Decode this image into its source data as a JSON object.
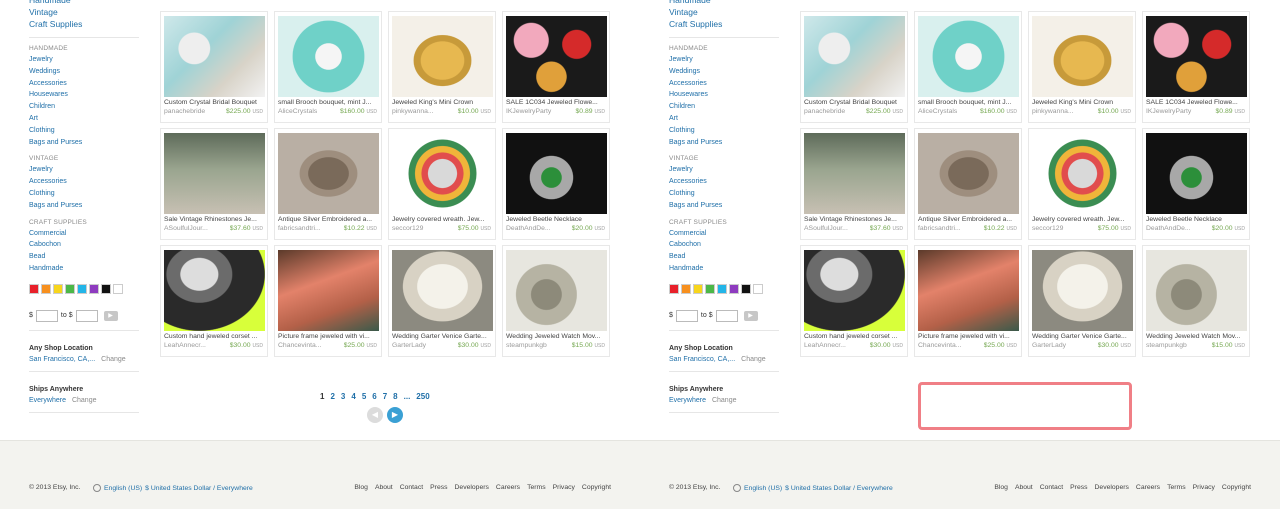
{
  "sidebar": {
    "top_links": [
      "Handmade",
      "Vintage",
      "Craft Supplies"
    ],
    "categories": [
      {
        "heading": "HANDMADE",
        "links": [
          "Jewelry",
          "Weddings",
          "Accessories",
          "Housewares",
          "Children",
          "Art",
          "Clothing",
          "Bags and Purses"
        ]
      },
      {
        "heading": "VINTAGE",
        "links": [
          "Jewelry",
          "Accessories",
          "Clothing",
          "Bags and Purses"
        ]
      },
      {
        "heading": "CRAFT SUPPLIES",
        "links": [
          "Commercial",
          "Cabochon",
          "Bead",
          "Handmade"
        ]
      }
    ],
    "colors": [
      "#e8202a",
      "#f7901e",
      "#f7d51d",
      "#4cb848",
      "#23b5e8",
      "#8e3bbf",
      "#111111",
      "#ffffff"
    ],
    "price_from_label": "$",
    "price_to_label": "to $",
    "shop_location_title": "Any Shop Location",
    "shop_location_value": "San Francisco, CA,...",
    "change_label": "Change",
    "ships_title": "Ships Anywhere",
    "ships_value": "Everywhere"
  },
  "listings": [
    {
      "title": "Custom Crystal Bridal Bouquet",
      "shop": "panachebride",
      "price": "$225.00",
      "currency": "USD"
    },
    {
      "title": "small Brooch bouquet, mint J...",
      "shop": "AliceCrystals",
      "price": "$160.00",
      "currency": "USD"
    },
    {
      "title": "Jeweled King's Mini Crown",
      "shop": "pinkywanna...",
      "price": "$10.00",
      "currency": "USD"
    },
    {
      "title": "SALE 1C034 Jeweled Flowe...",
      "shop": "IKJewelryParty",
      "price": "$0.89",
      "currency": "USD"
    },
    {
      "title": "Sale Vintage Rhinestones Je...",
      "shop": "ASoulfulJour...",
      "price": "$37.60",
      "currency": "USD"
    },
    {
      "title": "Antique Silver Embroidered a...",
      "shop": "fabricsandtri...",
      "price": "$10.22",
      "currency": "USD"
    },
    {
      "title": "Jewelry covered wreath. Jew...",
      "shop": "seccor129",
      "price": "$75.00",
      "currency": "USD"
    },
    {
      "title": "Jeweled Beetle Necklace",
      "shop": "DeathAndDe...",
      "price": "$20.00",
      "currency": "USD"
    },
    {
      "title": "Custom hand jeweled corset ...",
      "shop": "LeahAnnecr...",
      "price": "$30.00",
      "currency": "USD"
    },
    {
      "title": "Picture frame jeweled with vi...",
      "shop": "Chancevinta...",
      "price": "$25.00",
      "currency": "USD"
    },
    {
      "title": "Wedding Garter Venice Garte...",
      "shop": "GarterLady",
      "price": "$30.00",
      "currency": "USD"
    },
    {
      "title": "Wedding Jeweled Watch Mov...",
      "shop": "steampunkgb",
      "price": "$15.00",
      "currency": "USD"
    }
  ],
  "pagination": {
    "pages": [
      "1",
      "2",
      "3",
      "4",
      "5",
      "6",
      "7",
      "8",
      "...",
      "250"
    ],
    "current": "1",
    "prev_glyph": "◀",
    "next_glyph": "▶"
  },
  "footer": {
    "copyright": "© 2013 Etsy, Inc.",
    "language": "English (US)",
    "currency_region": "$ United States Dollar / Everywhere",
    "links": [
      "Blog",
      "About",
      "Contact",
      "Press",
      "Developers",
      "Careers",
      "Terms",
      "Privacy",
      "Copyright"
    ]
  },
  "highlight_color": "#f07f86"
}
